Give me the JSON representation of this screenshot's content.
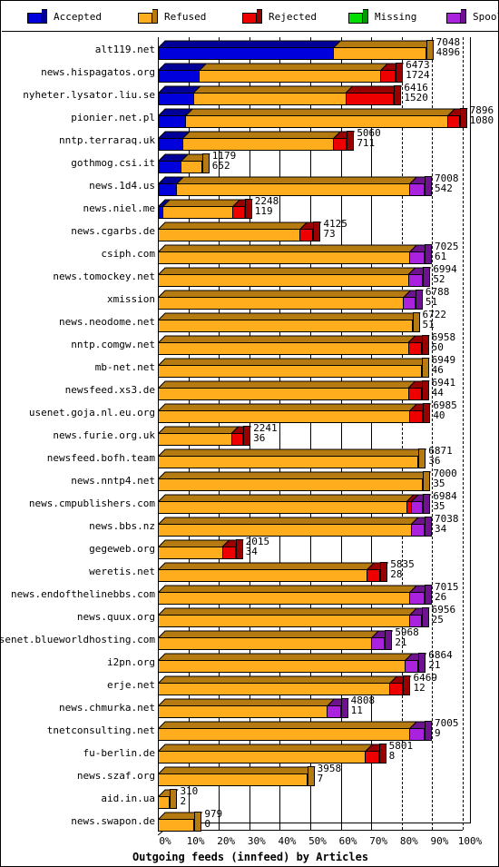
{
  "legend": {
    "items": [
      {
        "label": "Accepted",
        "color": "#0000dd",
        "side": "#000099",
        "icon": "cube-icon"
      },
      {
        "label": "Refused",
        "color": "#ffad1c",
        "side": "#b57a10",
        "icon": "cube-icon"
      },
      {
        "label": "Rejected",
        "color": "#ee0000",
        "side": "#990000",
        "icon": "cube-icon"
      },
      {
        "label": "Missing",
        "color": "#00dd00",
        "side": "#009900",
        "icon": "cube-icon"
      },
      {
        "label": "Spooled",
        "color": "#aa22dd",
        "side": "#6e128f",
        "icon": "cube-icon"
      }
    ]
  },
  "axis": {
    "x_title": "Outgoing feeds (innfeed) by Articles",
    "x_ticks": [
      "0%",
      "10%",
      "20%",
      "30%",
      "40%",
      "50%",
      "60%",
      "70%",
      "80%",
      "90%",
      "100%"
    ],
    "x_min": 0,
    "x_max": 100
  },
  "chart_data": {
    "type": "bar",
    "orientation": "horizontal",
    "stacked": true,
    "title": "Outgoing feeds (innfeed) by Articles",
    "xlabel": "Outgoing feeds (innfeed) by Articles",
    "ylabel": "",
    "xlim": [
      0,
      100
    ],
    "xunit": "percent",
    "grid": true,
    "legend_position": "top",
    "series_names": [
      "Accepted",
      "Refused",
      "Rejected",
      "Missing",
      "Spooled"
    ],
    "series_colors": [
      "#0000dd",
      "#ffad1c",
      "#ee0000",
      "#00dd00",
      "#aa22dd"
    ],
    "categories": [
      "alt119.net",
      "news.hispagatos.org",
      "nyheter.lysator.liu.se",
      "pionier.net.pl",
      "nntp.terraraq.uk",
      "gothmog.csi.it",
      "news.1d4.us",
      "news.niel.me",
      "news.cgarbs.de",
      "csiph.com",
      "news.tomockey.net",
      "xmission",
      "news.neodome.net",
      "nntp.comgw.net",
      "mb-net.net",
      "newsfeed.xs3.de",
      "usenet.goja.nl.eu.org",
      "news.furie.org.uk",
      "newsfeed.bofh.team",
      "news.nntp4.net",
      "news.cmpublishers.com",
      "news.bbs.nz",
      "gegeweb.org",
      "weretis.net",
      "news.endofthelinebbs.com",
      "news.quux.org",
      "usenet.blueworldhosting.com",
      "i2pn.org",
      "erje.net",
      "news.chmurka.net",
      "tnetconsulting.net",
      "fu-berlin.de",
      "news.szaf.org",
      "aid.in.ua",
      "news.swapon.de"
    ],
    "rows": [
      {
        "name": "alt119.net",
        "total": 7048,
        "sub": 4896,
        "pct": 88.0,
        "segments": [
          {
            "series": "Accepted",
            "pct": 57.5
          },
          {
            "series": "Refused",
            "pct": 30.5
          }
        ]
      },
      {
        "name": "news.hispagatos.org",
        "total": 6473,
        "sub": 1724,
        "pct": 78.0,
        "segments": [
          {
            "series": "Accepted",
            "pct": 13.5
          },
          {
            "series": "Refused",
            "pct": 59.5
          },
          {
            "series": "Rejected",
            "pct": 5.0
          }
        ]
      },
      {
        "name": "nyheter.lysator.liu.se",
        "total": 6416,
        "sub": 1520,
        "pct": 77.5,
        "segments": [
          {
            "series": "Accepted",
            "pct": 11.5
          },
          {
            "series": "Refused",
            "pct": 50.0
          },
          {
            "series": "Rejected",
            "pct": 16.0
          }
        ]
      },
      {
        "name": "pionier.net.pl",
        "total": 7896,
        "sub": 1080,
        "pct": 99.0,
        "segments": [
          {
            "series": "Accepted",
            "pct": 9.0
          },
          {
            "series": "Refused",
            "pct": 86.0
          },
          {
            "series": "Rejected",
            "pct": 4.0
          }
        ]
      },
      {
        "name": "nntp.terraraq.uk",
        "total": 5060,
        "sub": 711,
        "pct": 62.0,
        "segments": [
          {
            "series": "Accepted",
            "pct": 8.0
          },
          {
            "series": "Refused",
            "pct": 49.5
          },
          {
            "series": "Rejected",
            "pct": 4.5
          }
        ]
      },
      {
        "name": "gothmog.csi.it",
        "total": 1179,
        "sub": 652,
        "pct": 14.5,
        "segments": [
          {
            "series": "Accepted",
            "pct": 7.5
          },
          {
            "series": "Refused",
            "pct": 7.0
          }
        ]
      },
      {
        "name": "news.1d4.us",
        "total": 7008,
        "sub": 542,
        "pct": 87.5,
        "segments": [
          {
            "series": "Accepted",
            "pct": 6.0
          },
          {
            "series": "Refused",
            "pct": 76.5
          },
          {
            "series": "Spooled",
            "pct": 5.0
          }
        ]
      },
      {
        "name": "news.niel.me",
        "total": 2248,
        "sub": 119,
        "pct": 28.5,
        "segments": [
          {
            "series": "Accepted",
            "pct": 1.5
          },
          {
            "series": "Refused",
            "pct": 23.0
          },
          {
            "series": "Rejected",
            "pct": 4.0
          }
        ]
      },
      {
        "name": "news.cgarbs.de",
        "total": 4125,
        "sub": 73,
        "pct": 51.0,
        "segments": [
          {
            "series": "Refused",
            "pct": 46.5
          },
          {
            "series": "Rejected",
            "pct": 4.5
          }
        ]
      },
      {
        "name": "csiph.com",
        "total": 7025,
        "sub": 61,
        "pct": 87.5,
        "segments": [
          {
            "series": "Refused",
            "pct": 82.5
          },
          {
            "series": "Spooled",
            "pct": 5.0
          }
        ]
      },
      {
        "name": "news.tomockey.net",
        "total": 6994,
        "sub": 52,
        "pct": 87.0,
        "segments": [
          {
            "series": "Refused",
            "pct": 82.0
          },
          {
            "series": "Spooled",
            "pct": 5.0
          }
        ]
      },
      {
        "name": "xmission",
        "total": 6788,
        "sub": 51,
        "pct": 84.5,
        "segments": [
          {
            "series": "Refused",
            "pct": 80.5
          },
          {
            "series": "Spooled",
            "pct": 4.0
          }
        ]
      },
      {
        "name": "news.neodome.net",
        "total": 6722,
        "sub": 51,
        "pct": 83.5,
        "segments": [
          {
            "series": "Refused",
            "pct": 83.5
          }
        ]
      },
      {
        "name": "nntp.comgw.net",
        "total": 6958,
        "sub": 50,
        "pct": 86.5,
        "segments": [
          {
            "series": "Refused",
            "pct": 82.0
          },
          {
            "series": "Rejected",
            "pct": 4.5
          }
        ]
      },
      {
        "name": "mb-net.net",
        "total": 6949,
        "sub": 46,
        "pct": 86.5,
        "segments": [
          {
            "series": "Refused",
            "pct": 86.5
          }
        ]
      },
      {
        "name": "newsfeed.xs3.de",
        "total": 6941,
        "sub": 44,
        "pct": 86.5,
        "segments": [
          {
            "series": "Refused",
            "pct": 82.0
          },
          {
            "series": "Rejected",
            "pct": 4.5
          }
        ]
      },
      {
        "name": "usenet.goja.nl.eu.org",
        "total": 6985,
        "sub": 40,
        "pct": 87.0,
        "segments": [
          {
            "series": "Refused",
            "pct": 82.5
          },
          {
            "series": "Rejected",
            "pct": 4.5
          }
        ]
      },
      {
        "name": "news.furie.org.uk",
        "total": 2241,
        "sub": 36,
        "pct": 28.0,
        "segments": [
          {
            "series": "Refused",
            "pct": 24.0
          },
          {
            "series": "Rejected",
            "pct": 4.0
          }
        ]
      },
      {
        "name": "newsfeed.bofh.team",
        "total": 6871,
        "sub": 36,
        "pct": 85.5,
        "segments": [
          {
            "series": "Refused",
            "pct": 85.5
          }
        ]
      },
      {
        "name": "news.nntp4.net",
        "total": 7000,
        "sub": 35,
        "pct": 87.0,
        "segments": [
          {
            "series": "Refused",
            "pct": 87.0
          }
        ]
      },
      {
        "name": "news.cmpublishers.com",
        "total": 6984,
        "sub": 35,
        "pct": 87.0,
        "segments": [
          {
            "series": "Refused",
            "pct": 81.5
          },
          {
            "series": "Rejected",
            "pct": 1.5
          },
          {
            "series": "Spooled",
            "pct": 4.0
          }
        ]
      },
      {
        "name": "news.bbs.nz",
        "total": 7038,
        "sub": 34,
        "pct": 87.5,
        "segments": [
          {
            "series": "Refused",
            "pct": 83.0
          },
          {
            "series": "Spooled",
            "pct": 4.5
          }
        ]
      },
      {
        "name": "gegeweb.org",
        "total": 2015,
        "sub": 34,
        "pct": 25.5,
        "segments": [
          {
            "series": "Refused",
            "pct": 21.0
          },
          {
            "series": "Rejected",
            "pct": 4.5
          }
        ]
      },
      {
        "name": "weretis.net",
        "total": 5835,
        "sub": 28,
        "pct": 73.0,
        "segments": [
          {
            "series": "Refused",
            "pct": 68.5
          },
          {
            "series": "Rejected",
            "pct": 4.5
          }
        ]
      },
      {
        "name": "news.endofthelinebbs.com",
        "total": 7015,
        "sub": 26,
        "pct": 87.5,
        "segments": [
          {
            "series": "Refused",
            "pct": 82.5
          },
          {
            "series": "Spooled",
            "pct": 5.0
          }
        ]
      },
      {
        "name": "news.quux.org",
        "total": 6956,
        "sub": 25,
        "pct": 86.5,
        "segments": [
          {
            "series": "Refused",
            "pct": 82.5
          },
          {
            "series": "Spooled",
            "pct": 4.0
          }
        ]
      },
      {
        "name": "usenet.blueworldhosting.com",
        "total": 5968,
        "sub": 21,
        "pct": 74.5,
        "segments": [
          {
            "series": "Refused",
            "pct": 70.0
          },
          {
            "series": "Spooled",
            "pct": 4.5
          }
        ]
      },
      {
        "name": "i2pn.org",
        "total": 6864,
        "sub": 21,
        "pct": 85.5,
        "segments": [
          {
            "series": "Refused",
            "pct": 81.0
          },
          {
            "series": "Spooled",
            "pct": 4.5
          }
        ]
      },
      {
        "name": "erje.net",
        "total": 6469,
        "sub": 12,
        "pct": 80.5,
        "segments": [
          {
            "series": "Refused",
            "pct": 76.0
          },
          {
            "series": "Rejected",
            "pct": 4.5
          }
        ]
      },
      {
        "name": "news.chmurka.net",
        "total": 4808,
        "sub": 11,
        "pct": 60.0,
        "segments": [
          {
            "series": "Refused",
            "pct": 55.5
          },
          {
            "series": "Spooled",
            "pct": 4.5
          }
        ]
      },
      {
        "name": "tnetconsulting.net",
        "total": 7005,
        "sub": 9,
        "pct": 87.5,
        "segments": [
          {
            "series": "Refused",
            "pct": 82.5
          },
          {
            "series": "Spooled",
            "pct": 5.0
          }
        ]
      },
      {
        "name": "fu-berlin.de",
        "total": 5801,
        "sub": 8,
        "pct": 72.5,
        "segments": [
          {
            "series": "Refused",
            "pct": 68.0
          },
          {
            "series": "Rejected",
            "pct": 4.5
          }
        ]
      },
      {
        "name": "news.szaf.org",
        "total": 3958,
        "sub": 7,
        "pct": 49.0,
        "segments": [
          {
            "series": "Refused",
            "pct": 49.0
          }
        ]
      },
      {
        "name": "aid.in.ua",
        "total": 310,
        "sub": 2,
        "pct": 4.0,
        "segments": [
          {
            "series": "Refused",
            "pct": 4.0
          }
        ]
      },
      {
        "name": "news.swapon.de",
        "total": 979,
        "sub": 0,
        "pct": 12.0,
        "segments": [
          {
            "series": "Refused",
            "pct": 12.0
          }
        ]
      }
    ]
  }
}
